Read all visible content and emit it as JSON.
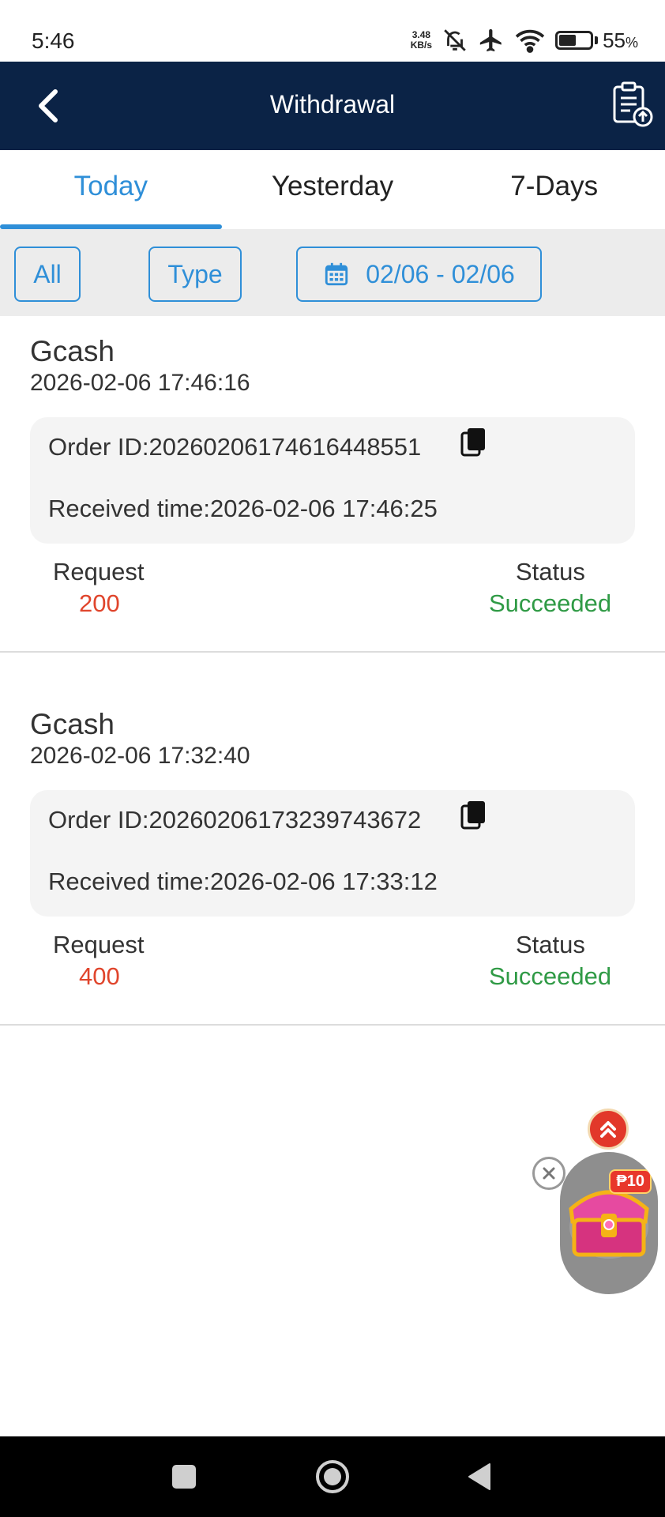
{
  "status_bar": {
    "time": "5:46",
    "net_speed_value": "3.48",
    "net_speed_unit": "KB/s",
    "battery_level": 55,
    "battery_text": "55",
    "battery_unit": "%"
  },
  "header": {
    "title": "Withdrawal"
  },
  "tabs": [
    {
      "label": "Today",
      "active": true
    },
    {
      "label": "Yesterday",
      "active": false
    },
    {
      "label": "7-Days",
      "active": false
    }
  ],
  "filters": {
    "all_label": "All",
    "type_label": "Type",
    "date_range": "02/06 - 02/06"
  },
  "records": [
    {
      "method": "Gcash",
      "created": "2026-02-06 17:46:16",
      "order_id": "Order ID:20260206174616448551",
      "received": "Received time:2026-02-06 17:46:25",
      "request_label": "Request",
      "request_amount": "200",
      "status_label": "Status",
      "status": "Succeeded"
    },
    {
      "method": "Gcash",
      "created": "2026-02-06 17:32:40",
      "order_id": "Order ID:20260206173239743672",
      "received": "Received time:2026-02-06 17:33:12",
      "request_label": "Request",
      "request_amount": "400",
      "status_label": "Status",
      "status": "Succeeded"
    }
  ],
  "promo": {
    "badge": "₱10"
  },
  "colors": {
    "header_bg": "#0b2346",
    "accent": "#2f8fd8",
    "amount": "#e0452c",
    "success": "#2f9a45"
  },
  "icons": [
    "back-arrow-icon",
    "record-upload-icon",
    "calendar-icon",
    "copy-icon",
    "double-chevron-up-icon",
    "close-icon",
    "treasure-chest-icon",
    "nav-recents-icon",
    "nav-home-icon",
    "nav-back-icon"
  ]
}
